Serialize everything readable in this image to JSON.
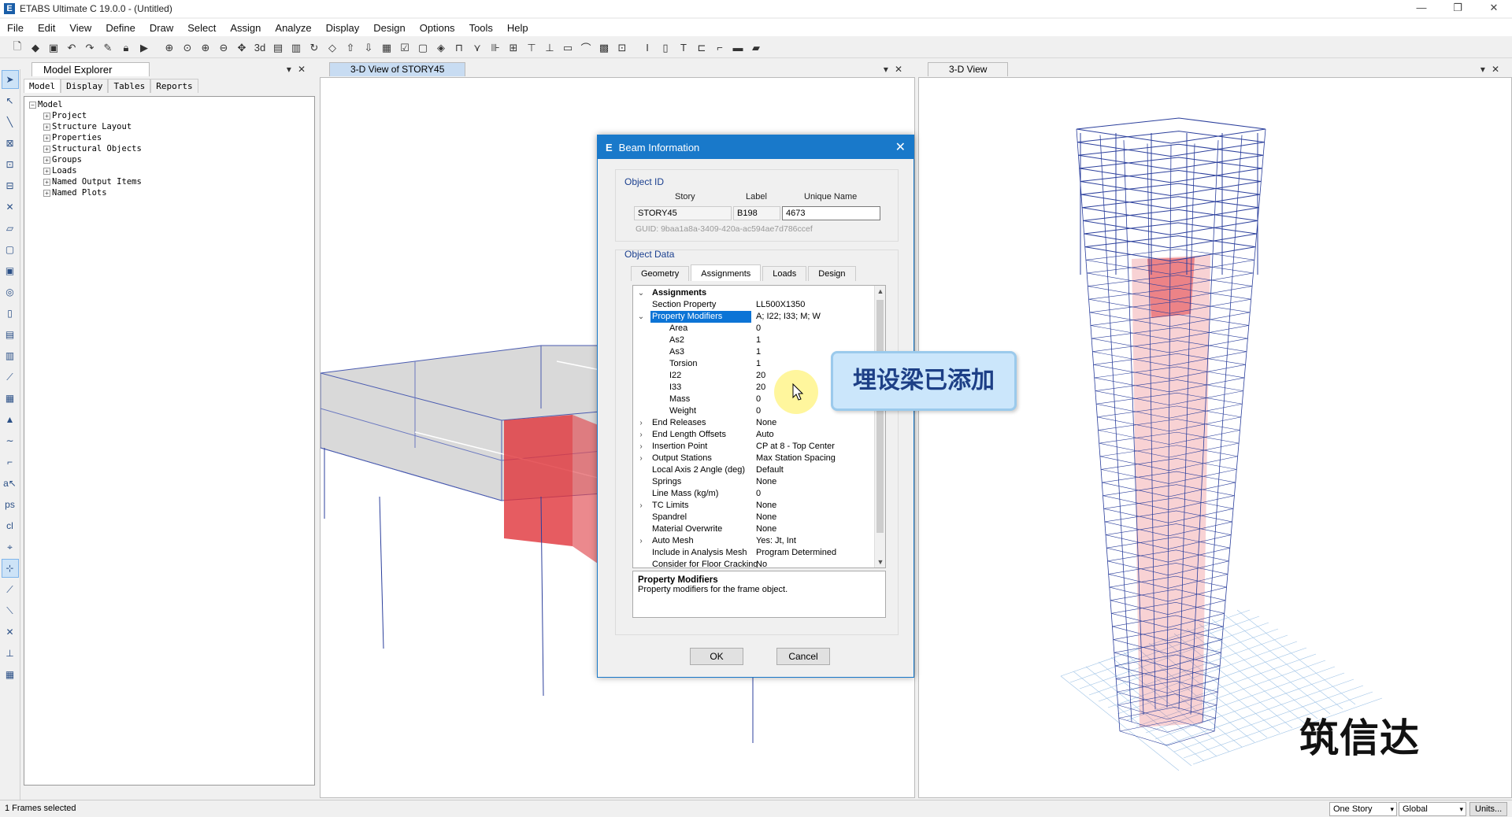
{
  "window": {
    "logo": "E",
    "title": "ETABS Ultimate C 19.0.0 - (Untitled)",
    "minimize": "—",
    "restore": "❐",
    "close": "✕"
  },
  "menu": [
    "File",
    "Edit",
    "View",
    "Define",
    "Draw",
    "Select",
    "Assign",
    "Analyze",
    "Display",
    "Design",
    "Options",
    "Tools",
    "Help"
  ],
  "explorer": {
    "title": "Model Explorer",
    "tabs": [
      "Model",
      "Display",
      "Tables",
      "Reports"
    ],
    "tree_root": "Model",
    "tree_items": [
      "Project",
      "Structure Layout",
      "Properties",
      "Structural Objects",
      "Groups",
      "Loads",
      "Named Output Items",
      "Named Plots"
    ]
  },
  "views": {
    "left_title": "3-D View of STORY45",
    "right_title": "3-D View"
  },
  "dialog": {
    "title": "Beam Information",
    "object_id_label": "Object ID",
    "col_story": "Story",
    "col_label": "Label",
    "col_unique": "Unique Name",
    "story": "STORY45",
    "label": "B198",
    "unique_name": "4673",
    "guid": "GUID:  9baa1a8a-3409-420a-ac594ae7d786ccef",
    "object_data_label": "Object Data",
    "tabs": [
      "Geometry",
      "Assignments",
      "Loads",
      "Design"
    ],
    "properties": [
      {
        "exp": "⌄",
        "name": "Assignments",
        "value": "",
        "bold": true
      },
      {
        "exp": "",
        "name": "Section Property",
        "value": "LL500X1350"
      },
      {
        "exp": "⌄",
        "name": "Property Modifiers",
        "value": "A; I22; I33; M; W",
        "selected": true
      },
      {
        "exp": "",
        "name": "Area",
        "value": "0",
        "sub": true
      },
      {
        "exp": "",
        "name": "As2",
        "value": "1",
        "sub": true
      },
      {
        "exp": "",
        "name": "As3",
        "value": "1",
        "sub": true
      },
      {
        "exp": "",
        "name": "Torsion",
        "value": "1",
        "sub": true
      },
      {
        "exp": "",
        "name": "I22",
        "value": "20",
        "sub": true
      },
      {
        "exp": "",
        "name": "I33",
        "value": "20",
        "sub": true
      },
      {
        "exp": "",
        "name": "Mass",
        "value": "0",
        "sub": true
      },
      {
        "exp": "",
        "name": "Weight",
        "value": "0",
        "sub": true
      },
      {
        "exp": "›",
        "name": "End Releases",
        "value": "None"
      },
      {
        "exp": "›",
        "name": "End Length Offsets",
        "value": "Auto"
      },
      {
        "exp": "›",
        "name": "Insertion Point",
        "value": "CP at 8 - Top Center"
      },
      {
        "exp": "›",
        "name": "Output Stations",
        "value": "Max Station Spacing"
      },
      {
        "exp": "",
        "name": "Local Axis 2 Angle (deg)",
        "value": "Default"
      },
      {
        "exp": "",
        "name": "Springs",
        "value": "None"
      },
      {
        "exp": "",
        "name": "Line Mass (kg/m)",
        "value": "0"
      },
      {
        "exp": "›",
        "name": "TC Limits",
        "value": "None"
      },
      {
        "exp": "",
        "name": "Spandrel",
        "value": "None"
      },
      {
        "exp": "",
        "name": "Material Overwrite",
        "value": "None"
      },
      {
        "exp": "›",
        "name": "Auto Mesh",
        "value": "Yes: Jt, Int"
      },
      {
        "exp": "",
        "name": "Include in Analysis Mesh",
        "value": "Program Determined"
      },
      {
        "exp": "",
        "name": "Consider for Floor Cracking",
        "value": "No"
      }
    ],
    "desc_title": "Property Modifiers",
    "desc_text": "Property modifiers for the frame object.",
    "ok": "OK",
    "cancel": "Cancel"
  },
  "callout": "埋设梁已添加",
  "watermark": "筑信达",
  "status": {
    "text": "1 Frames selected",
    "story_sel": "One Story",
    "coord_sel": "Global",
    "units_btn": "Units..."
  },
  "colors": {
    "accent": "#1979ca",
    "frame_blue": "#2b3f9c",
    "core_red": "#e0333a"
  }
}
